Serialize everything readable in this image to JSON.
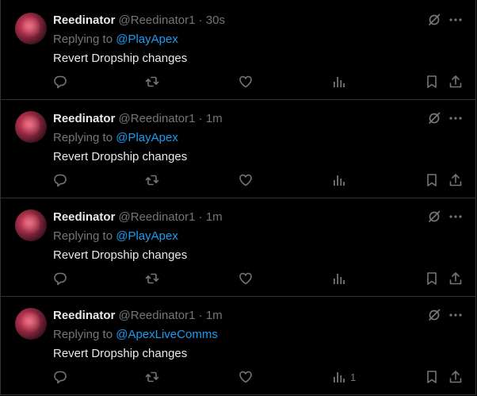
{
  "tweets": [
    {
      "name": "Reedinator",
      "handle": "@Reedinator1",
      "dot": "·",
      "time": "30s",
      "replying_prefix": "Replying to",
      "mention": "@PlayApex",
      "text": "Revert Dropship changes",
      "views": ""
    },
    {
      "name": "Reedinator",
      "handle": "@Reedinator1",
      "dot": "·",
      "time": "1m",
      "replying_prefix": "Replying to",
      "mention": "@PlayApex",
      "text": "Revert Dropship changes",
      "views": ""
    },
    {
      "name": "Reedinator",
      "handle": "@Reedinator1",
      "dot": "·",
      "time": "1m",
      "replying_prefix": "Replying to",
      "mention": "@PlayApex",
      "text": "Revert Dropship changes",
      "views": ""
    },
    {
      "name": "Reedinator",
      "handle": "@Reedinator1",
      "dot": "·",
      "time": "1m",
      "replying_prefix": "Replying to",
      "mention": "@ApexLiveComms",
      "text": "Revert Dropship changes",
      "views": "1"
    }
  ],
  "icons": {
    "grok": "grok-icon",
    "more": "more-options-icon",
    "reply": "reply-icon",
    "repost": "repost-icon",
    "like": "like-icon",
    "views": "views-icon",
    "bookmark": "bookmark-icon",
    "share": "share-icon"
  },
  "colors": {
    "background": "#000000",
    "text": "#e7e9ea",
    "muted": "#71767b",
    "link": "#1d9bf0",
    "border": "#2f3336"
  }
}
